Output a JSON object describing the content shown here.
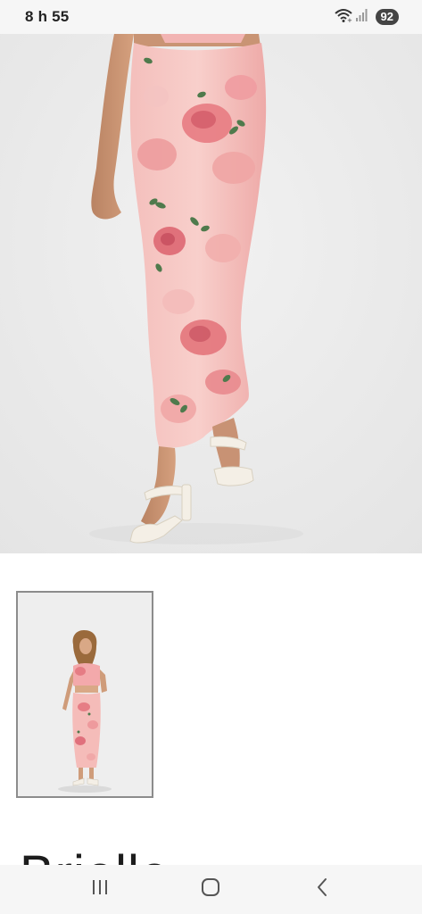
{
  "status_bar": {
    "time": "8 h 55",
    "battery": "92",
    "icons": [
      "wifi-icon",
      "signal-icon"
    ]
  },
  "product": {
    "title": "Brielle",
    "main_image": "model-floral-maxi-skirt-photo",
    "thumbnail_image": "model-full-outfit-thumbnail"
  },
  "nav_bar": {
    "icons": [
      "recent-apps-icon",
      "home-icon",
      "back-icon"
    ]
  },
  "colors": {
    "status_bg": "#f6f6f6",
    "photo_bg": "#ececec",
    "skirt_pink": "#f3b9b7",
    "rose": "#e0707c",
    "leaf": "#4f7a4c",
    "sandal": "#f4efe6",
    "thumb_border": "#8c8c8c"
  }
}
